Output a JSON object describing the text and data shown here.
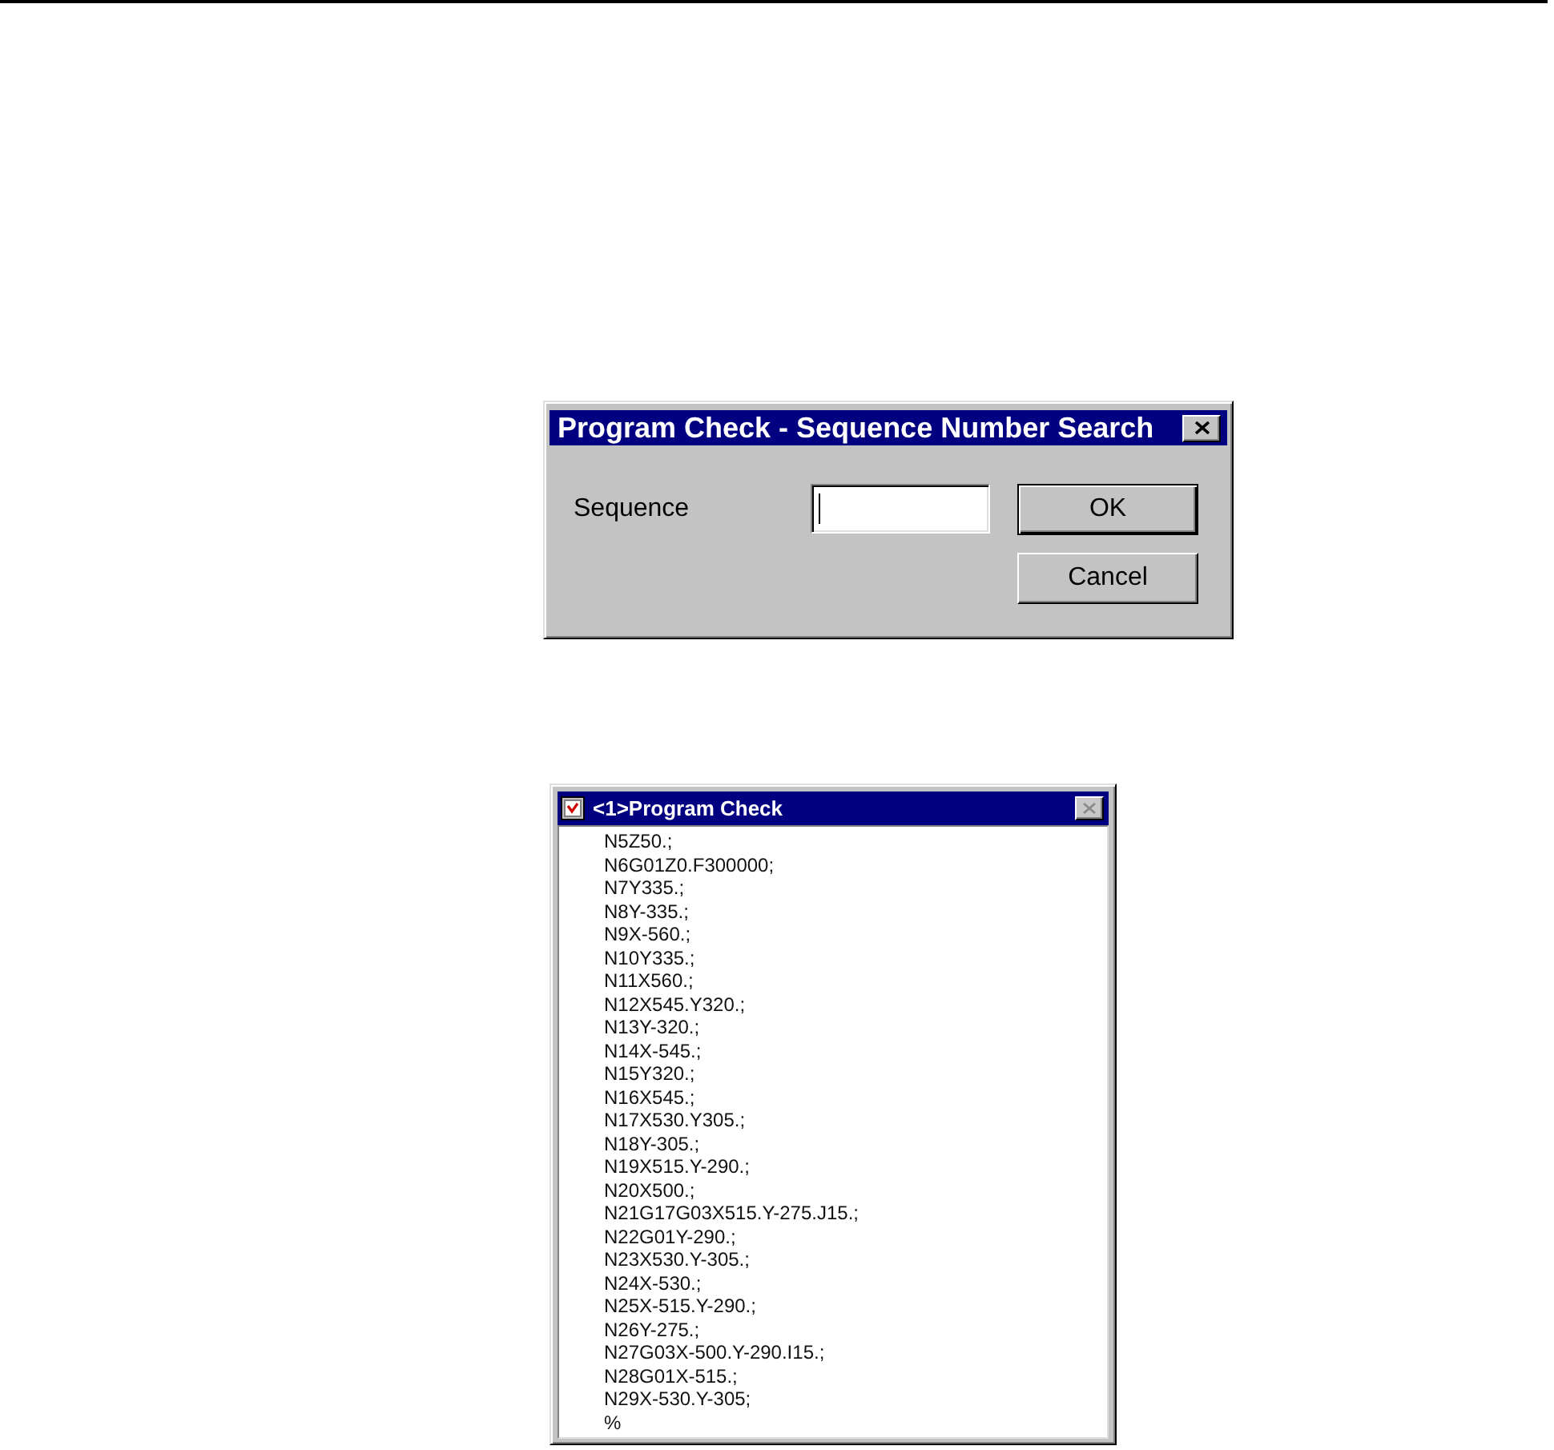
{
  "search_dialog": {
    "title": "Program Check - Sequence Number Search",
    "close_button": {
      "disabled": false
    },
    "field": {
      "label": "Sequence",
      "focused": true
    },
    "buttons": [
      {
        "label": "OK",
        "default": true
      },
      {
        "label": "Cancel",
        "default": false
      }
    ]
  },
  "program_window": {
    "title": "<1>Program Check",
    "close_button": {
      "disabled": true
    },
    "lines": [
      "N5Z50.;",
      "N6G01Z0.F300000;",
      "N7Y335.;",
      "N8Y-335.;",
      "N9X-560.;",
      "N10Y335.;",
      "N11X560.;",
      "N12X545.Y320.;",
      "N13Y-320.;",
      "N14X-545.;",
      "N15Y320.;",
      "N16X545.;",
      "N17X530.Y305.;",
      "N18Y-305.;",
      "N19X515.Y-290.;",
      "N20X500.;",
      "N21G17G03X515.Y-275.J15.;",
      "N22G01Y-290.;",
      "N23X530.Y-305.;",
      "N24X-530.;",
      "N25X-515.Y-290.;",
      "N26Y-275.;",
      "N27G03X-500.Y-290.I15.;",
      "N28G01X-515.;",
      "N29X-530.Y-305;",
      "%"
    ]
  }
}
